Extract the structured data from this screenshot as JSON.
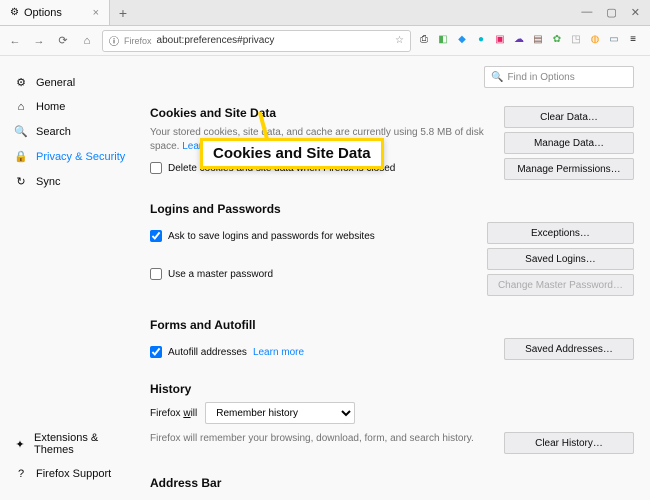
{
  "window": {
    "tab_title": "Options",
    "url_prefix": "Firefox",
    "url": "about:preferences#privacy"
  },
  "find": {
    "placeholder": "Find in Options"
  },
  "sidebar": {
    "items": [
      {
        "icon": "⚙",
        "label": "General"
      },
      {
        "icon": "⌂",
        "label": "Home"
      },
      {
        "icon": "🔍",
        "label": "Search"
      },
      {
        "icon": "🔒",
        "label": "Privacy & Security"
      },
      {
        "icon": "↻",
        "label": "Sync"
      }
    ],
    "footer": [
      {
        "icon": "✦",
        "label": "Extensions & Themes"
      },
      {
        "icon": "?",
        "label": "Firefox Support"
      }
    ]
  },
  "cookies": {
    "heading": "Cookies and Site Data",
    "desc_a": "Your stored cookies, site data, and cache are currently using 5.8 MB of disk space.",
    "learn_more": "Learn more",
    "delete_label": "Delete cookies and site data when Firefox is closed",
    "btn_clear": "Clear Data…",
    "btn_manage": "Manage Data…",
    "btn_perm": "Manage Permissions…"
  },
  "logins": {
    "heading": "Logins and Passwords",
    "ask_label": "Ask to save logins and passwords for websites",
    "master_label": "Use a master password",
    "btn_exceptions": "Exceptions…",
    "btn_saved": "Saved Logins…",
    "btn_change": "Change Master Password…"
  },
  "forms": {
    "heading": "Forms and Autofill",
    "autofill_label": "Autofill addresses",
    "learn_more": "Learn more",
    "btn_saved": "Saved Addresses…"
  },
  "history": {
    "heading": "History",
    "will_label": "Firefox will",
    "select_value": "Remember history",
    "desc": "Firefox will remember your browsing, download, form, and search history.",
    "btn_clear": "Clear History…"
  },
  "address": {
    "heading": "Address Bar"
  },
  "callout": "Cookies and Site Data"
}
